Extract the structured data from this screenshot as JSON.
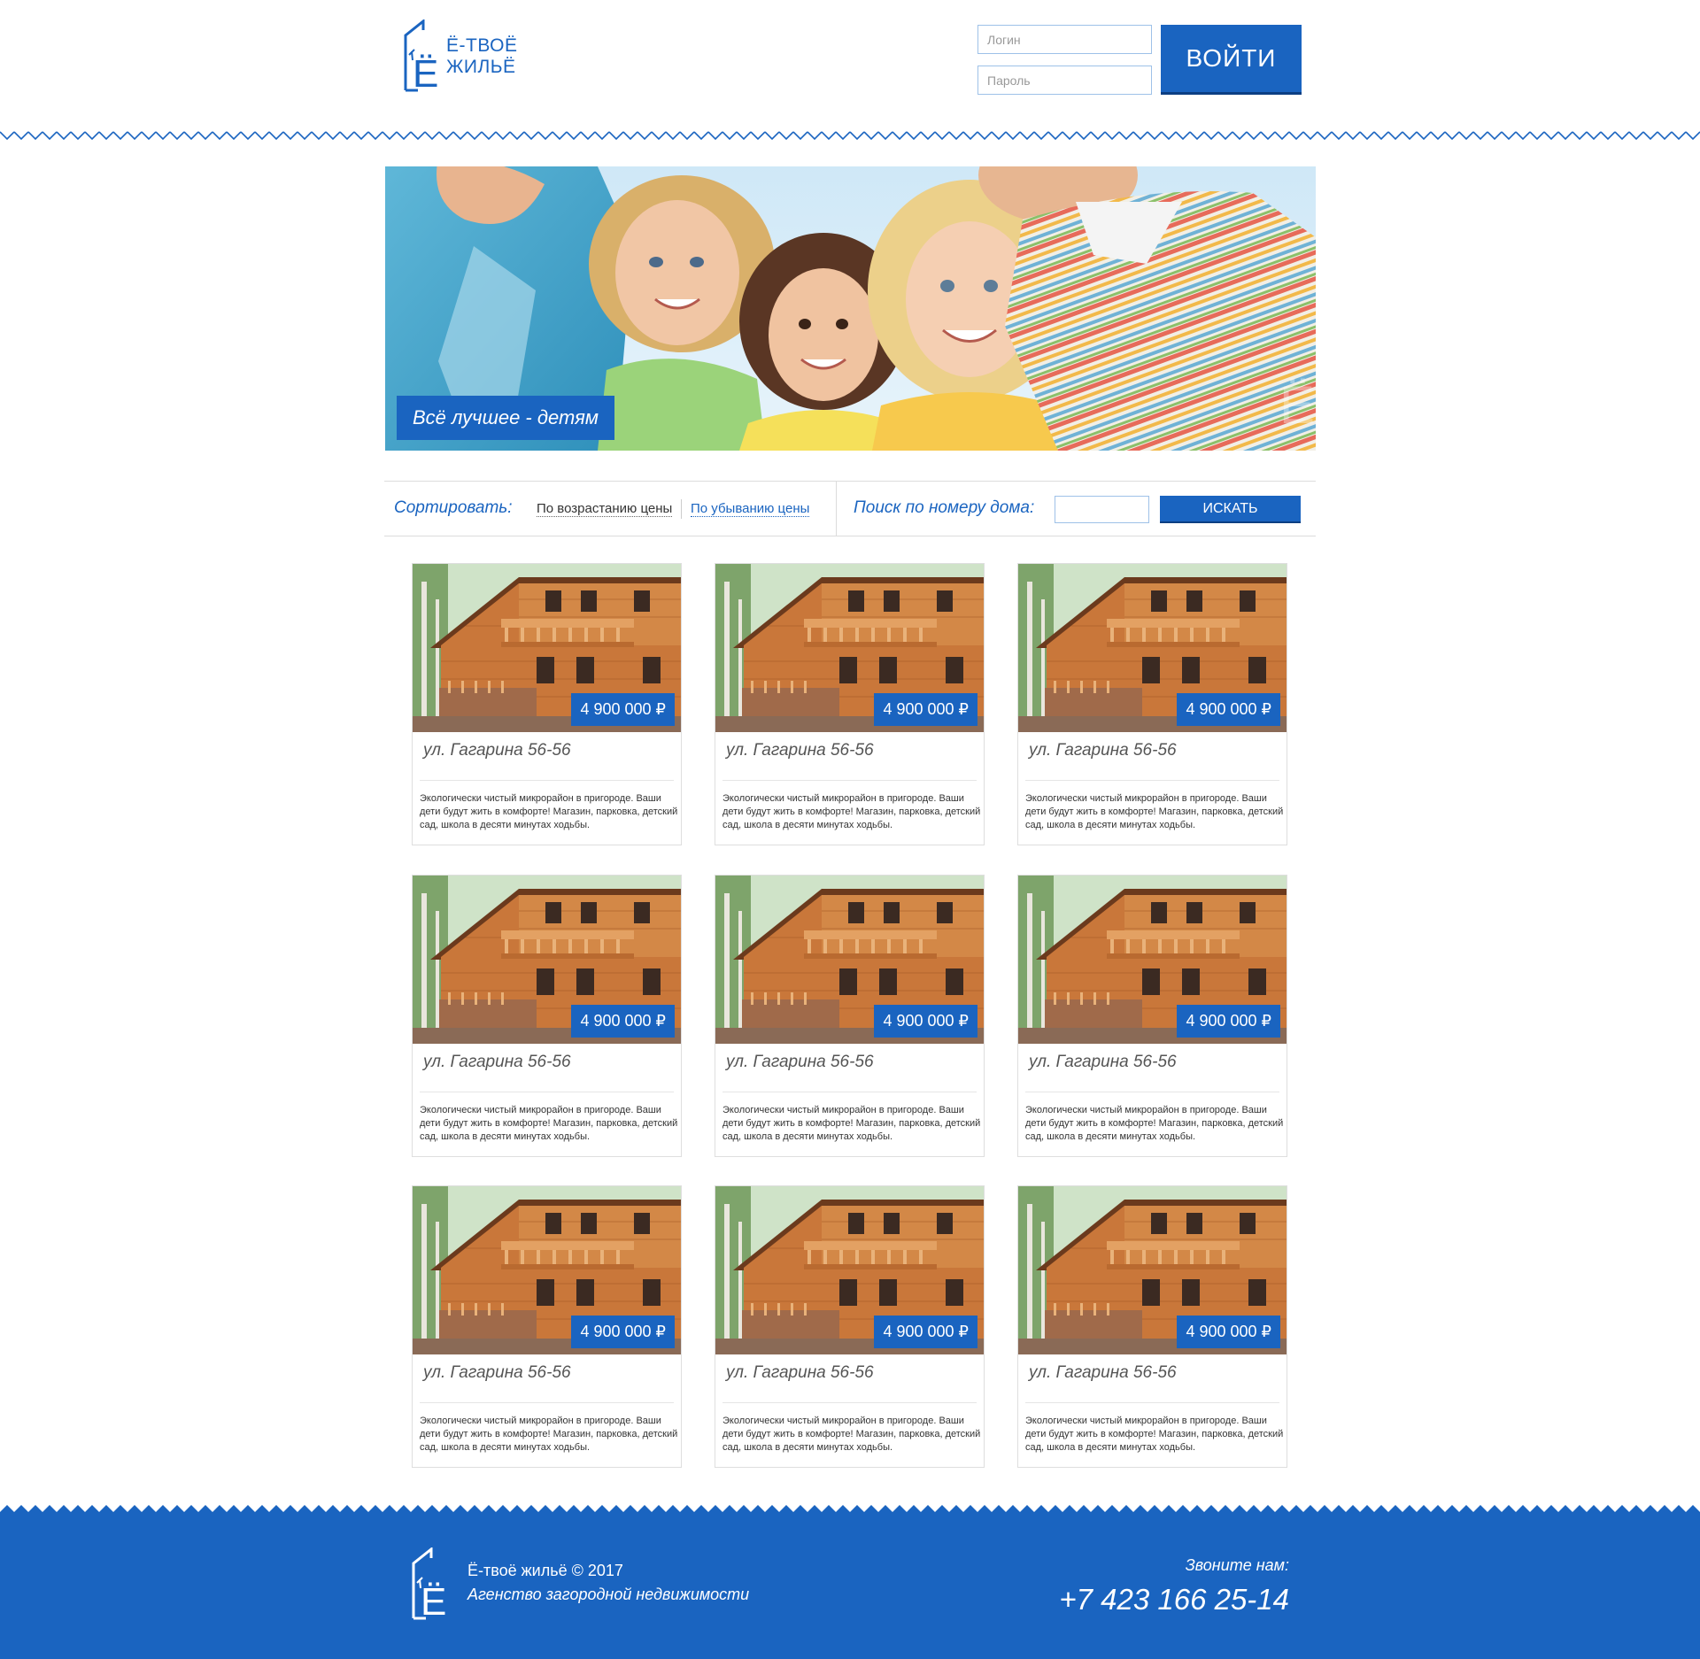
{
  "header": {
    "logo_line1": "Ё-ТВОЁ",
    "logo_line2": "ЖИЛЬЁ",
    "login_placeholder": "Логин",
    "password_placeholder": "Пароль",
    "login_button": "ВОЙТИ"
  },
  "hero": {
    "caption": "Всё лучшее - детям"
  },
  "filter": {
    "sort_label": "Сортировать:",
    "sort_asc": "По возрастанию цены",
    "sort_desc": "По убыванию цены",
    "search_label": "Поиск по номеру дома:",
    "search_value": "",
    "search_button": "ИСКАТЬ"
  },
  "listings": [
    {
      "price": "4 900 000 ₽",
      "address": "ул. Гагарина 56-56",
      "description": "Экологически чистый микрорайон в пригороде. Ваши дети будут жить в комфорте! Магазин, парковка, детский сад, школа в десяти минутах ходьбы."
    },
    {
      "price": "4 900 000 ₽",
      "address": "ул. Гагарина 56-56",
      "description": "Экологически чистый микрорайон в пригороде. Ваши дети будут жить в комфорте! Магазин, парковка, детский сад, школа в десяти минутах ходьбы."
    },
    {
      "price": "4 900 000 ₽",
      "address": "ул. Гагарина 56-56",
      "description": "Экологически чистый микрорайон в пригороде. Ваши дети будут жить в комфорте! Магазин, парковка, детский сад, школа в десяти минутах ходьбы."
    },
    {
      "price": "4 900 000 ₽",
      "address": "ул. Гагарина 56-56",
      "description": "Экологически чистый микрорайон в пригороде. Ваши дети будут жить в комфорте! Магазин, парковка, детский сад, школа в десяти минутах ходьбы."
    },
    {
      "price": "4 900 000 ₽",
      "address": "ул. Гагарина 56-56",
      "description": "Экологически чистый микрорайон в пригороде. Ваши дети будут жить в комфорте! Магазин, парковка, детский сад, школа в десяти минутах ходьбы."
    },
    {
      "price": "4 900 000 ₽",
      "address": "ул. Гагарина 56-56",
      "description": "Экологически чистый микрорайон в пригороде. Ваши дети будут жить в комфорте! Магазин, парковка, детский сад, школа в десяти минутах ходьбы."
    },
    {
      "price": "4 900 000 ₽",
      "address": "ул. Гагарина 56-56",
      "description": "Экологически чистый микрорайон в пригороде. Ваши дети будут жить в комфорте! Магазин, парковка, детский сад, школа в десяти минутах ходьбы."
    },
    {
      "price": "4 900 000 ₽",
      "address": "ул. Гагарина 56-56",
      "description": "Экологически чистый микрорайон в пригороде. Ваши дети будут жить в комфорте! Магазин, парковка, детский сад, школа в десяти минутах ходьбы."
    },
    {
      "price": "4 900 000 ₽",
      "address": "ул. Гагарина 56-56",
      "description": "Экологически чистый микрорайон в пригороде. Ваши дети будут жить в комфорте! Магазин, парковка, детский сад, школа в десяти минутах ходьбы."
    }
  ],
  "footer": {
    "copyright": "Ё-твоё жильё © 2017",
    "tagline": "Агенство загородной недвижимости",
    "call_label": "Звоните нам:",
    "phone": "+7 423 166 25-14"
  },
  "colors": {
    "brand_blue": "#1a64c0",
    "brand_blue_dark": "#0c3f82",
    "border": "#dcdcdc"
  },
  "icons": {
    "logo": "house-with-letter-yo-icon",
    "card_photo": "wooden-house-photo",
    "hero_photo": "smiling-children-photo"
  }
}
